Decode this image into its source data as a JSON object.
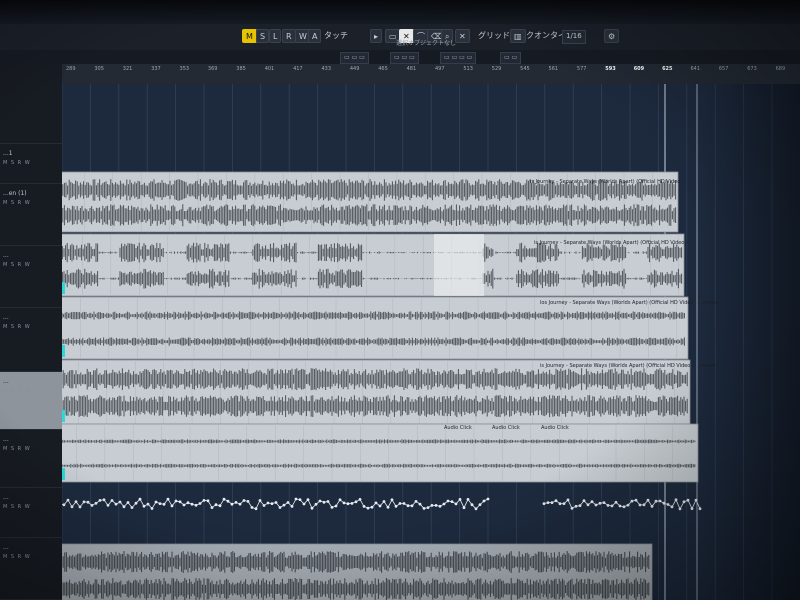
{
  "toolbar": {
    "buttons": [
      {
        "id": "mode-m",
        "label": "M",
        "active": true
      },
      {
        "id": "mode-s",
        "label": "S",
        "active": false
      },
      {
        "id": "mode-l",
        "label": "L",
        "active": false
      },
      {
        "id": "mode-r",
        "label": "R",
        "active": false
      },
      {
        "id": "mode-w",
        "label": "W",
        "active": false
      },
      {
        "id": "mode-a",
        "label": "A",
        "active": false
      }
    ],
    "snap_label": "タッチ",
    "grid_label": "グリッド",
    "quantize_label": "クオンタイズ値",
    "quantize_value": "1/16",
    "accent_color": "#e6c400"
  },
  "status_message": "選択オブジェクトなし",
  "ruler": {
    "bars": [
      "289",
      "305",
      "321",
      "337",
      "353",
      "369",
      "385",
      "401",
      "417",
      "433",
      "449",
      "465",
      "481",
      "497",
      "513",
      "529",
      "545",
      "561",
      "577",
      "593",
      "609",
      "625",
      "641",
      "657",
      "673",
      "689"
    ],
    "highlight": [
      "593",
      "609",
      "625"
    ]
  },
  "tracks": [
    {
      "name": "",
      "controls": ""
    },
    {
      "name": "...1",
      "controls": "M S R W"
    },
    {
      "name": "...en (1)",
      "controls": "M S R W"
    },
    {
      "name": "...",
      "controls": "M S R W"
    },
    {
      "name": "...",
      "controls": "M S R W"
    },
    {
      "name": "...",
      "controls": "M S R W"
    },
    {
      "name": "...",
      "controls": "M S R W"
    },
    {
      "name": "...",
      "controls": "M S R W"
    },
    {
      "name": "...",
      "controls": "M S R W"
    }
  ],
  "clips": {
    "clip1_label": "is Journey - Separate Ways (Worlds Apart) (Official HD Video - ...",
    "clip2_label": "is Journey - Separate Ways (Worlds Apart) (Official HD Video - ...",
    "clip3_label": "los Journey - Separate Ways (Worlds Apart) (Official HD Video - ...mixed",
    "clip4_label": "is Journey - Separate Ways (Worlds Apart) (Official HD Video - ...mixed",
    "audio_click_labels": [
      "Audio Click",
      "Audio Click",
      "Audio Click"
    ]
  },
  "colors": {
    "timeline_bg": "#1d2a3e",
    "clip_bg": "#c7cdd2",
    "waveform": "#4c5258",
    "selected_track": "#8d949c"
  }
}
